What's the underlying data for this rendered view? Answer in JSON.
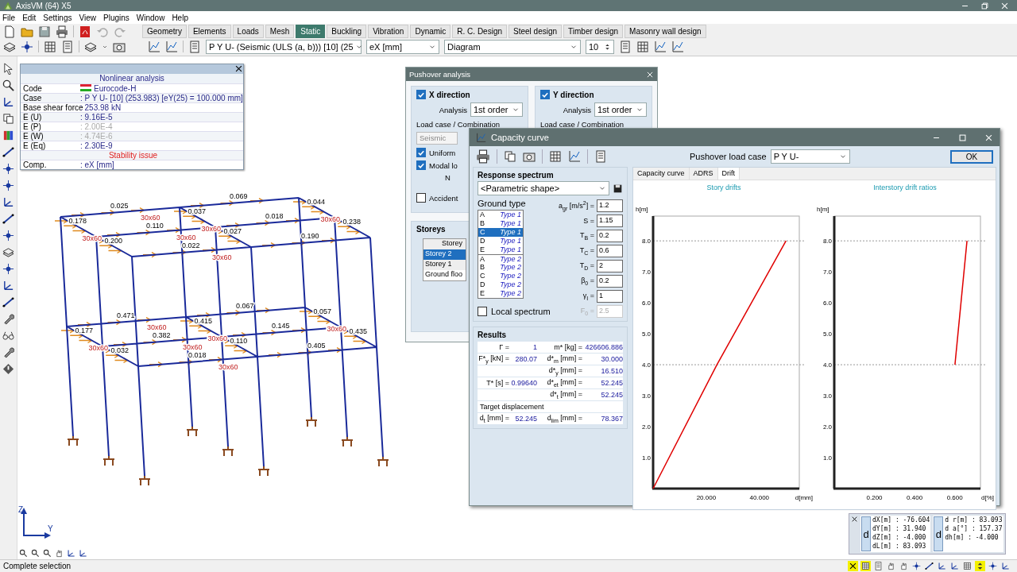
{
  "window": {
    "title": "AxisVM (64) X5"
  },
  "menu": [
    "File",
    "Edit",
    "Settings",
    "View",
    "Plugins",
    "Window",
    "Help"
  ],
  "toolbar": {
    "module_tabs": [
      {
        "label": "Geometry",
        "selected": false
      },
      {
        "label": "Elements",
        "selected": false
      },
      {
        "label": "Loads",
        "selected": false
      },
      {
        "label": "Mesh",
        "selected": false
      },
      {
        "label": "Static",
        "selected": true
      },
      {
        "label": "Buckling",
        "selected": false
      },
      {
        "label": "Vibration",
        "selected": false
      },
      {
        "label": "Dynamic",
        "selected": false
      },
      {
        "label": "R. C. Design",
        "selected": false
      },
      {
        "label": "Steel design",
        "selected": false
      },
      {
        "label": "Timber design",
        "selected": false
      },
      {
        "label": "Masonry wall design",
        "selected": false
      }
    ],
    "result_case": "P Y U- (Seismic (ULS (a, b))) [10] (25",
    "component": "eX [mm]",
    "display": "Diagram",
    "count": "10"
  },
  "nonlinear_panel": {
    "title": "Nonlinear analysis",
    "rows": [
      {
        "kind": "flag",
        "label": "Code",
        "value": "Eurocode-H",
        "disabled": false
      },
      {
        "kind": "row",
        "label": "Case",
        "value": ": P Y U- [10] (253.983) [eY(25) = 100.000 mm]",
        "disabled": false
      },
      {
        "kind": "row",
        "label": "Base shear force",
        "value": ": 253.98 kN",
        "disabled": false
      },
      {
        "kind": "row",
        "label": "E (U)",
        "value": ": 9.16E-5",
        "disabled": false
      },
      {
        "kind": "row",
        "label": "E (P)",
        "value": ": 2.00E-4",
        "disabled": true
      },
      {
        "kind": "row",
        "label": "E (W)",
        "value": ": 4.74E-6",
        "disabled": true
      },
      {
        "kind": "row",
        "label": "E (Eq)",
        "value": ": 2.30E-9",
        "disabled": false
      },
      {
        "kind": "warning",
        "label": "Stability issue",
        "disabled": false
      },
      {
        "kind": "row",
        "label": "Comp.",
        "value": ": eX [mm]",
        "disabled": false
      }
    ]
  },
  "model_labels": [
    "0.471",
    "0.067",
    "0.382",
    "0.145",
    "0.018",
    "0.405",
    "0.177",
    "0.032",
    "0.415",
    "0.110",
    "0.057",
    "0.435",
    "0.025",
    "0.069",
    "0.110",
    "0.018",
    "0.022",
    "0.190",
    "0.178",
    "0.200",
    "0.037",
    "0.027",
    "0.044",
    "0.238"
  ],
  "section_labels": [
    "30x60",
    "30x60",
    "30x60",
    "30x60",
    "30x60",
    "30x60",
    "30x60",
    "30x60",
    "30x60",
    "30x60",
    "30x60",
    "30x60"
  ],
  "axes": {
    "vertical": "Z",
    "horizontal": "Y"
  },
  "pushover": {
    "title": "Pushover analysis",
    "directions": [
      {
        "label": "X direction",
        "checked": true,
        "analysis_label": "Analysis",
        "analysis": "1st order",
        "load_case_label": "Load case / Combination",
        "load_case": "Seismic",
        "options": [
          {
            "label": "Uniform",
            "checked": true
          },
          {
            "label": "Modal lo",
            "checked": true
          }
        ],
        "note": "N",
        "accidental": {
          "label": "Accident",
          "checked": false
        }
      },
      {
        "label": "Y direction",
        "checked": true,
        "analysis_label": "Analysis",
        "analysis": "1st order",
        "load_case_label": "Load case / Combination"
      }
    ],
    "storeys": {
      "title": "Storeys",
      "column": "Storey",
      "rows": [
        {
          "label": "Storey 2",
          "selected": true
        },
        {
          "label": "Storey 1",
          "selected": false
        },
        {
          "label": "Ground floo",
          "selected": false
        }
      ]
    }
  },
  "capacity": {
    "title": "Capacity curve",
    "load_case_label": "Pushover load case",
    "load_case": "P Y U-",
    "ok": "OK",
    "spectrum": {
      "title": "Response spectrum",
      "shape": "<Parametric shape>",
      "ground_label": "Ground type",
      "ground_types": [
        {
          "class": "A",
          "type": "Type 1",
          "selected": false
        },
        {
          "class": "B",
          "type": "Type 1",
          "selected": false
        },
        {
          "class": "C",
          "type": "Type 1",
          "selected": true
        },
        {
          "class": "D",
          "type": "Type 1",
          "selected": false
        },
        {
          "class": "E",
          "type": "Type 1",
          "selected": false
        },
        {
          "class": "A",
          "type": "Type 2",
          "selected": false
        },
        {
          "class": "B",
          "type": "Type 2",
          "selected": false
        },
        {
          "class": "C",
          "type": "Type 2",
          "selected": false
        },
        {
          "class": "D",
          "type": "Type 2",
          "selected": false
        },
        {
          "class": "E",
          "type": "Type 2",
          "selected": false
        }
      ],
      "params": [
        {
          "label": "a$_{gr}$ [m/s$^{2}$] =",
          "value": "1.2",
          "disabled": false
        },
        {
          "label": "S =",
          "value": "1.15",
          "disabled": false
        },
        {
          "label": "T$_{B}$ =",
          "value": "0.2",
          "disabled": false
        },
        {
          "label": "T$_{C}$ =",
          "value": "0.6",
          "disabled": false
        },
        {
          "label": "T$_{D}$ =",
          "value": "2",
          "disabled": false
        },
        {
          "label": "β$_{0}$ =",
          "value": "0.2",
          "disabled": false
        },
        {
          "label": "γ$_{I}$ =",
          "value": "1",
          "disabled": false
        },
        {
          "label": "F$_{0}$ =",
          "value": "2.5",
          "disabled": true
        }
      ],
      "local": {
        "label": "Local spectrum",
        "checked": false
      }
    },
    "results": {
      "title": "Results",
      "rows": [
        {
          "left": {
            "label": "Γ =",
            "value": "1"
          },
          "right": {
            "label": "m* [kg] =",
            "value": "426606.886"
          }
        },
        {
          "left": {
            "label": "F*$_{y}$ [kN] =",
            "value": "280.07"
          },
          "right": {
            "label": "d*$_{m}$ [mm] =",
            "value": "30.000"
          }
        },
        {
          "right": {
            "label": "d*$_{y}$ [mm] =",
            "value": "16.510"
          }
        },
        {
          "left": {
            "label": "T* [s] =",
            "value": "0.99640"
          },
          "right": {
            "label": "d*$_{et}$ [mm] =",
            "value": "52.245"
          }
        },
        {
          "right": {
            "label": "d*$_{t}$ [mm] =",
            "value": "52.245"
          }
        }
      ],
      "target_title": "Target displacement",
      "target": {
        "left": {
          "label": "d$_{t}$ [mm] =",
          "value": "52.245"
        },
        "right": {
          "label": "d$_{lim}$ [mm] =",
          "value": "78.367"
        }
      }
    },
    "tabs": [
      {
        "label": "Capacity curve",
        "selected": false
      },
      {
        "label": "ADRS",
        "selected": false
      },
      {
        "label": "Drift",
        "selected": true
      }
    ],
    "charts": [
      {
        "chart_data": {
          "type": "line",
          "title": "Story drifts",
          "xlabel": "d[mm]",
          "ylabel": "h[m]",
          "x": [
            0,
            24,
            50
          ],
          "series": [
            {
              "color": "#e00000",
              "values": [
                0,
                4,
                8
              ]
            }
          ],
          "xlim": [
            0,
            55
          ],
          "ylim": [
            0,
            8.8
          ],
          "xticks": [
            {
              "value": 20,
              "label": "20.000"
            },
            {
              "value": 40,
              "label": "40.000"
            }
          ],
          "yticks": [
            {
              "value": 1,
              "label": "1.0"
            },
            {
              "value": 2,
              "label": "2.0"
            },
            {
              "value": 3,
              "label": "3.0"
            },
            {
              "value": 4,
              "label": "4.0"
            },
            {
              "value": 5,
              "label": "5.0"
            },
            {
              "value": 6,
              "label": "6.0"
            },
            {
              "value": 7,
              "label": "7.0"
            },
            {
              "value": 8,
              "label": "8.0"
            }
          ]
        }
      },
      {
        "chart_data": {
          "type": "line",
          "title": "Interstory drift ratios",
          "xlabel": "d[%]",
          "ylabel": "h[m]",
          "x": [
            0.601,
            0.661
          ],
          "series": [
            {
              "color": "#e00000",
              "values": [
                4,
                8
              ]
            }
          ],
          "xlim": [
            0,
            0.728
          ],
          "ylim": [
            0,
            8.8
          ],
          "xticks": [
            {
              "value": 0.2,
              "label": "0.200"
            },
            {
              "value": 0.4,
              "label": "0.400"
            },
            {
              "value": 0.6,
              "label": "0.600"
            }
          ],
          "yticks": [
            {
              "value": 1,
              "label": "1.0"
            },
            {
              "value": 2,
              "label": "2.0"
            },
            {
              "value": 3,
              "label": "3.0"
            },
            {
              "value": 4,
              "label": "4.0"
            },
            {
              "value": 5,
              "label": "5.0"
            },
            {
              "value": 6,
              "label": "6.0"
            },
            {
              "value": 7,
              "label": "7.0"
            },
            {
              "value": 8,
              "label": "8.0"
            }
          ]
        }
      }
    ]
  },
  "coordinates": [
    {
      "badge": "d",
      "lines": [
        "dX[m] : -76.604",
        "dY[m] : 31.940",
        "dZ[m] : -4.000",
        "dL[m] : 83.093"
      ]
    },
    {
      "badge": "d",
      "lines": [
        "d r[m] : 83.093",
        "d a[°] : 157.37",
        "dh[m] : -4.000"
      ]
    }
  ],
  "status_bar": {
    "text": "Complete selection"
  },
  "status_toggles": [
    {
      "on": true
    },
    {
      "on": true
    },
    {
      "on": false
    },
    {
      "on": false
    },
    {
      "on": false
    },
    {
      "on": false
    },
    {
      "on": false
    },
    {
      "on": false
    },
    {
      "on": false
    },
    {
      "on": false
    },
    {
      "on": true
    },
    {
      "on": false
    },
    {
      "on": false
    }
  ]
}
